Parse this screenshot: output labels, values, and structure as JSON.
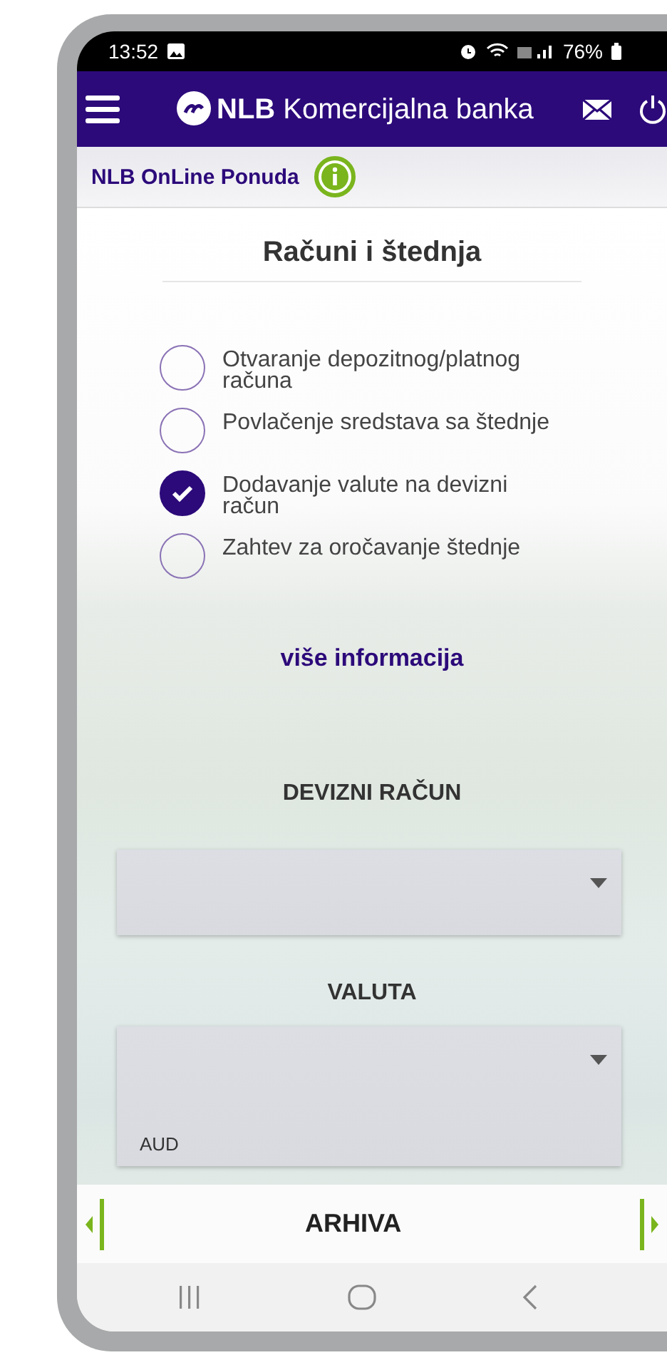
{
  "status_bar": {
    "time": "13:52",
    "battery": "76%"
  },
  "header": {
    "brand_bold": "NLB",
    "brand": "Komercijalna banka"
  },
  "subheader": {
    "title": "NLB OnLine Ponuda"
  },
  "section": {
    "title": "Računi i štednja"
  },
  "options": [
    {
      "label": "Otvaranje depozitnog/platnog računa",
      "selected": false
    },
    {
      "label": "Povlačenje sredstava sa štednje",
      "selected": false
    },
    {
      "label": "Dodavanje valute na devizni račun",
      "selected": true
    },
    {
      "label": "Zahtev za oročavanje štednje",
      "selected": false
    }
  ],
  "more_link": "više informacija",
  "fields": [
    {
      "label": "DEVIZNI RAČUN",
      "expanded": false
    },
    {
      "label": "VALUTA",
      "expanded": true,
      "options": [
        "AUD"
      ]
    }
  ],
  "bottom_bar": {
    "title": "ARHIVA"
  }
}
